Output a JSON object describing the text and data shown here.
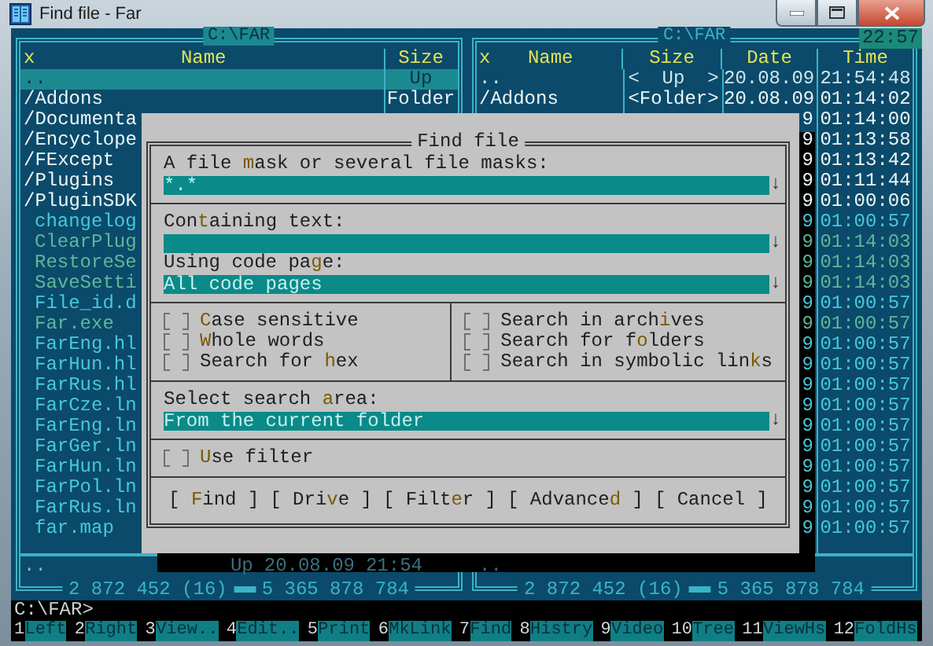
{
  "window": {
    "title": "Find file - Far"
  },
  "clock": "22:57",
  "left_panel": {
    "path": "C:\\FAR",
    "active": true,
    "header": {
      "mark": "x",
      "name": "Name",
      "size": "Size"
    },
    "rows": [
      {
        "name": "..",
        "size": "Up",
        "kind": "up",
        "selected": true
      },
      {
        "name": "/Addons",
        "size": "Folder",
        "kind": "folder",
        "selected": false
      },
      {
        "name": "/Documenta",
        "kind": "folder",
        "selected": false
      },
      {
        "name": "/Encyclope",
        "kind": "folder",
        "selected": false
      },
      {
        "name": "/FExcept",
        "kind": "folder",
        "selected": false
      },
      {
        "name": "/Plugins",
        "kind": "folder",
        "selected": false
      },
      {
        "name": "/PluginSDK",
        "kind": "folder",
        "selected": false
      },
      {
        "name": "changelog",
        "kind": "file",
        "selected": false
      },
      {
        "name": "ClearPlug",
        "kind": "exe",
        "selected": false
      },
      {
        "name": "RestoreSe",
        "kind": "exe",
        "selected": false
      },
      {
        "name": "SaveSetti",
        "kind": "exe",
        "selected": false
      },
      {
        "name": "File_id.d",
        "kind": "file",
        "selected": false
      },
      {
        "name": "Far.exe",
        "kind": "exe",
        "selected": false
      },
      {
        "name": "FarEng.hl",
        "kind": "file",
        "selected": false
      },
      {
        "name": "FarHun.hl",
        "kind": "file",
        "selected": false
      },
      {
        "name": "FarRus.hl",
        "kind": "file",
        "selected": false
      },
      {
        "name": "FarCze.ln",
        "kind": "file",
        "selected": false
      },
      {
        "name": "FarEng.ln",
        "kind": "file",
        "selected": false
      },
      {
        "name": "FarGer.ln",
        "kind": "file",
        "selected": false
      },
      {
        "name": "FarHun.ln",
        "kind": "file",
        "selected": false
      },
      {
        "name": "FarPol.ln",
        "kind": "file",
        "selected": false
      },
      {
        "name": "FarRus.ln",
        "kind": "file",
        "selected": false
      },
      {
        "name": "far.map",
        "kind": "file",
        "selected": false
      }
    ],
    "status": {
      "name": "..",
      "size": "Up",
      "date": "20.08.09",
      "time": "21:54"
    },
    "totals": [
      "2 872 452 (16)",
      "5 365 878 784"
    ]
  },
  "right_panel": {
    "path": "C:\\FAR",
    "active": false,
    "header": {
      "mark": "x",
      "name": "Name",
      "size": "Size",
      "date": "Date",
      "time": "Time"
    },
    "rows": [
      {
        "name": "..",
        "size": "<  Up  >",
        "date": "20.08.09",
        "time": "21:54:48",
        "kind": "up",
        "selected": false
      },
      {
        "name": "/Addons",
        "size": "<Folder>",
        "date": "20.08.09",
        "time": "01:14:02",
        "kind": "folder",
        "selected": false
      },
      {
        "date": "9",
        "time": "01:14:00",
        "kind": "folder",
        "selected": false
      },
      {
        "date": "9",
        "time": "01:13:58",
        "kind": "folder",
        "selected": false
      },
      {
        "date": "9",
        "time": "01:13:42",
        "kind": "folder",
        "selected": false
      },
      {
        "date": "9",
        "time": "01:11:44",
        "kind": "folder",
        "selected": false
      },
      {
        "date": "9",
        "time": "01:00:06",
        "kind": "folder",
        "selected": false
      },
      {
        "date": "9",
        "time": "01:00:57",
        "kind": "file",
        "selected": false
      },
      {
        "date": "9",
        "time": "01:14:03",
        "kind": "exe",
        "selected": false
      },
      {
        "date": "9",
        "time": "01:14:03",
        "kind": "exe",
        "selected": false
      },
      {
        "date": "9",
        "time": "01:14:03",
        "kind": "exe",
        "selected": false
      },
      {
        "date": "9",
        "time": "01:00:57",
        "kind": "file",
        "selected": false
      },
      {
        "date": "9",
        "time": "01:00:57",
        "kind": "exe",
        "selected": false
      },
      {
        "date": "9",
        "time": "01:00:57",
        "kind": "file",
        "selected": false
      },
      {
        "date": "9",
        "time": "01:00:57",
        "kind": "file",
        "selected": false
      },
      {
        "date": "9",
        "time": "01:00:57",
        "kind": "file",
        "selected": false
      },
      {
        "date": "9",
        "time": "01:00:57",
        "kind": "file",
        "selected": false
      },
      {
        "date": "9",
        "time": "01:00:57",
        "kind": "file",
        "selected": false
      },
      {
        "date": "9",
        "time": "01:00:57",
        "kind": "file",
        "selected": false
      },
      {
        "date": "9",
        "time": "01:00:57",
        "kind": "file",
        "selected": false
      },
      {
        "date": "9",
        "time": "01:00:57",
        "kind": "file",
        "selected": false
      },
      {
        "date": "9",
        "time": "01:00:57",
        "kind": "file",
        "selected": false
      },
      {
        "date": "9",
        "time": "01:00:57",
        "kind": "file",
        "selected": false
      }
    ],
    "status": {
      "name": ".."
    },
    "totals": [
      "2 872 452 (16)",
      "5 365 878 784"
    ]
  },
  "dialog": {
    "title": "Find file",
    "mask": {
      "label": "A file **m**ask or several file masks:",
      "value": "*.*",
      "arrow": "↓"
    },
    "text": {
      "label": "Con**t**aining text:",
      "arrow": "↓"
    },
    "code_page": {
      "label": "Using code pa**g**e:",
      "value": "All code pages",
      "arrow": "↓"
    },
    "options_left": [
      {
        "label": "**C**ase sensitive",
        "checked": false
      },
      {
        "label": "**W**hole words",
        "checked": false
      },
      {
        "label": "Search for **h**ex",
        "checked": false
      }
    ],
    "options_right": [
      {
        "label": "Search in arch**i**ves",
        "checked": false
      },
      {
        "label": "Search for f**o**lders",
        "checked": false
      },
      {
        "label": "Search in symbolic lin**k**s",
        "checked": false
      }
    ],
    "area": {
      "label": "Select search **a**rea:",
      "value": "From the current folder",
      "arrow": "↓"
    },
    "filter": {
      "label": "**U**se filter",
      "checked": false
    },
    "buttons": [
      "[ **F**ind ]",
      "[ Dri**v**e ]",
      "[ Filt**e**r ]",
      "[ Advance**d** ]",
      "[ Cancel ]"
    ]
  },
  "command_line": {
    "prompt": "C:\\FAR>"
  },
  "keybar": [
    {
      "key": "1",
      "label": "Left"
    },
    {
      "key": "2",
      "label": "Right"
    },
    {
      "key": "3",
      "label": "View.."
    },
    {
      "key": "4",
      "label": "Edit.."
    },
    {
      "key": "5",
      "label": "Print"
    },
    {
      "key": "6",
      "label": "MkLink"
    },
    {
      "key": "7",
      "label": "Find"
    },
    {
      "key": "8",
      "label": "Histry"
    },
    {
      "key": "9",
      "label": "Video"
    },
    {
      "key": "10",
      "label": "Tree"
    },
    {
      "key": "11",
      "label": "ViewHs"
    },
    {
      "key": "12",
      "label": "FoldHs"
    }
  ]
}
